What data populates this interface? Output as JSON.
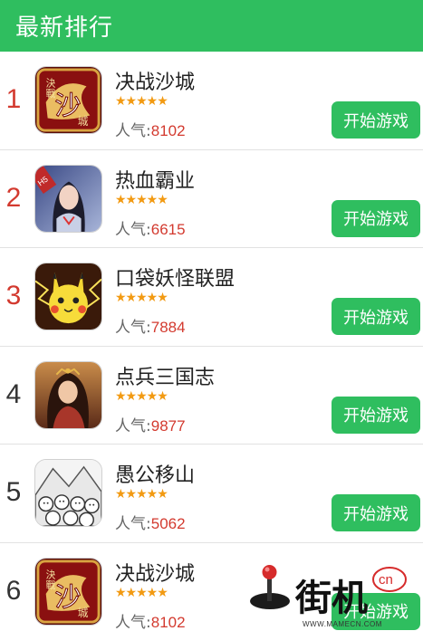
{
  "header": {
    "title": "最新排行"
  },
  "colors": {
    "accent": "#2fbe5f",
    "rank_top": "#d33a2f",
    "rank_other": "#333333",
    "star": "#f29a12",
    "pop_value": "#d33a2f"
  },
  "pop_label": "人气:",
  "games": [
    {
      "rank": "1",
      "name": "决战沙城",
      "stars": "★★★★★",
      "rating": 5,
      "popularity": "8102",
      "button": "开始游戏",
      "icon": "juezhan-shacheng-icon"
    },
    {
      "rank": "2",
      "name": "热血霸业",
      "stars": "★★★★★",
      "rating": 5,
      "popularity": "6615",
      "button": "开始游戏",
      "icon": "rexue-baye-icon"
    },
    {
      "rank": "3",
      "name": "口袋妖怪联盟",
      "stars": "★★★★★",
      "rating": 5,
      "popularity": "7884",
      "button": "开始游戏",
      "icon": "pikachu-icon"
    },
    {
      "rank": "4",
      "name": "点兵三国志",
      "stars": "★★★★★",
      "rating": 5,
      "popularity": "9877",
      "button": "开始游戏",
      "icon": "dianbing-sanguozhi-icon"
    },
    {
      "rank": "5",
      "name": "愚公移山",
      "stars": "★★★★★",
      "rating": 5,
      "popularity": "5062",
      "button": "开始游戏",
      "icon": "yugong-yishan-icon"
    },
    {
      "rank": "6",
      "name": "决战沙城",
      "stars": "★★★★★",
      "rating": 5,
      "popularity": "8102",
      "button": "开始游戏",
      "icon": "juezhan-shacheng-icon"
    }
  ],
  "watermark": {
    "site": "WWW.MAMECN.COM",
    "suffix": "cn",
    "glyphs": "街机"
  }
}
